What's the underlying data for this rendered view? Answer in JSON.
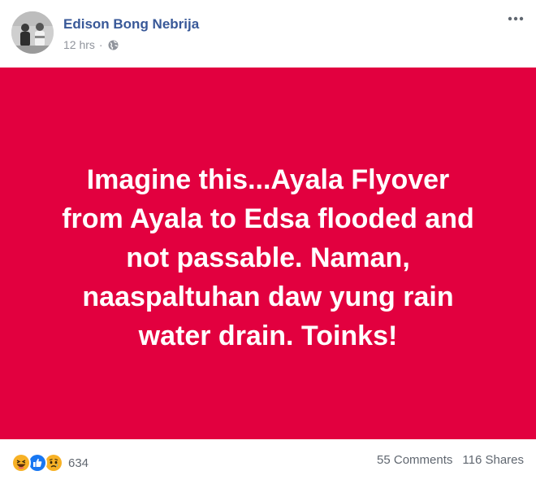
{
  "post": {
    "author": "Edison Bong Nebrija",
    "time": "12 hrs",
    "separator": "·",
    "privacy_icon": "globe-icon",
    "more_icon": "more-options-icon",
    "background_color": "#e2003f",
    "text_lines": [
      "Imagine this...Ayala Flyover",
      "from Ayala to Edsa flooded and",
      "not passable. Naman,",
      "naaspaltuhan daw yung rain",
      "water drain. Toinks!"
    ]
  },
  "footer": {
    "reaction_icons": [
      "haha-icon",
      "like-icon",
      "sad-icon"
    ],
    "reaction_count": "634",
    "comments": "55 Comments",
    "shares": "116 Shares"
  },
  "colors": {
    "author_link": "#385898",
    "meta_text": "#90949c",
    "stats_text": "#606770"
  }
}
